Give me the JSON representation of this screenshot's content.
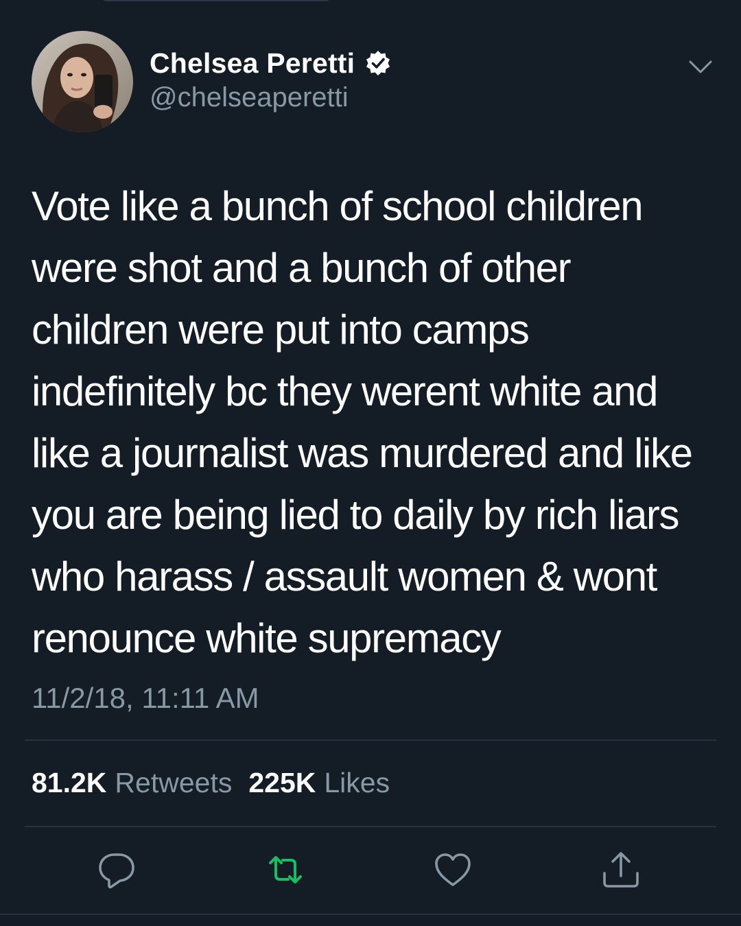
{
  "colors": {
    "background": "#141d26",
    "text_primary": "#ffffff",
    "text_secondary": "#8899a6",
    "divider": "#253341",
    "retweet_active": "#17bf63",
    "verified_badge": "#ffffff"
  },
  "author": {
    "display_name": "Chelsea Peretti",
    "handle": "@chelseaperetti",
    "verified": true,
    "avatar_icon": "profile-photo"
  },
  "tweet": {
    "lines": [
      "Vote like a bunch of school children",
      "were shot and a bunch of other",
      "children were put into camps",
      "indefinitely bc they werent white and",
      "like a journalist was murdered and like",
      "you are being lied to daily by rich liars",
      "who harass / assault women & wont",
      "renounce white supremacy"
    ],
    "timestamp": "11/2/18, 11:11 AM"
  },
  "stats": {
    "retweets_count": "81.2K",
    "retweets_label": "Retweets",
    "likes_count": "225K",
    "likes_label": "Likes"
  },
  "actions": {
    "reply_icon": "reply-icon",
    "retweet_icon": "retweet-icon",
    "like_icon": "heart-icon",
    "share_icon": "share-icon"
  }
}
